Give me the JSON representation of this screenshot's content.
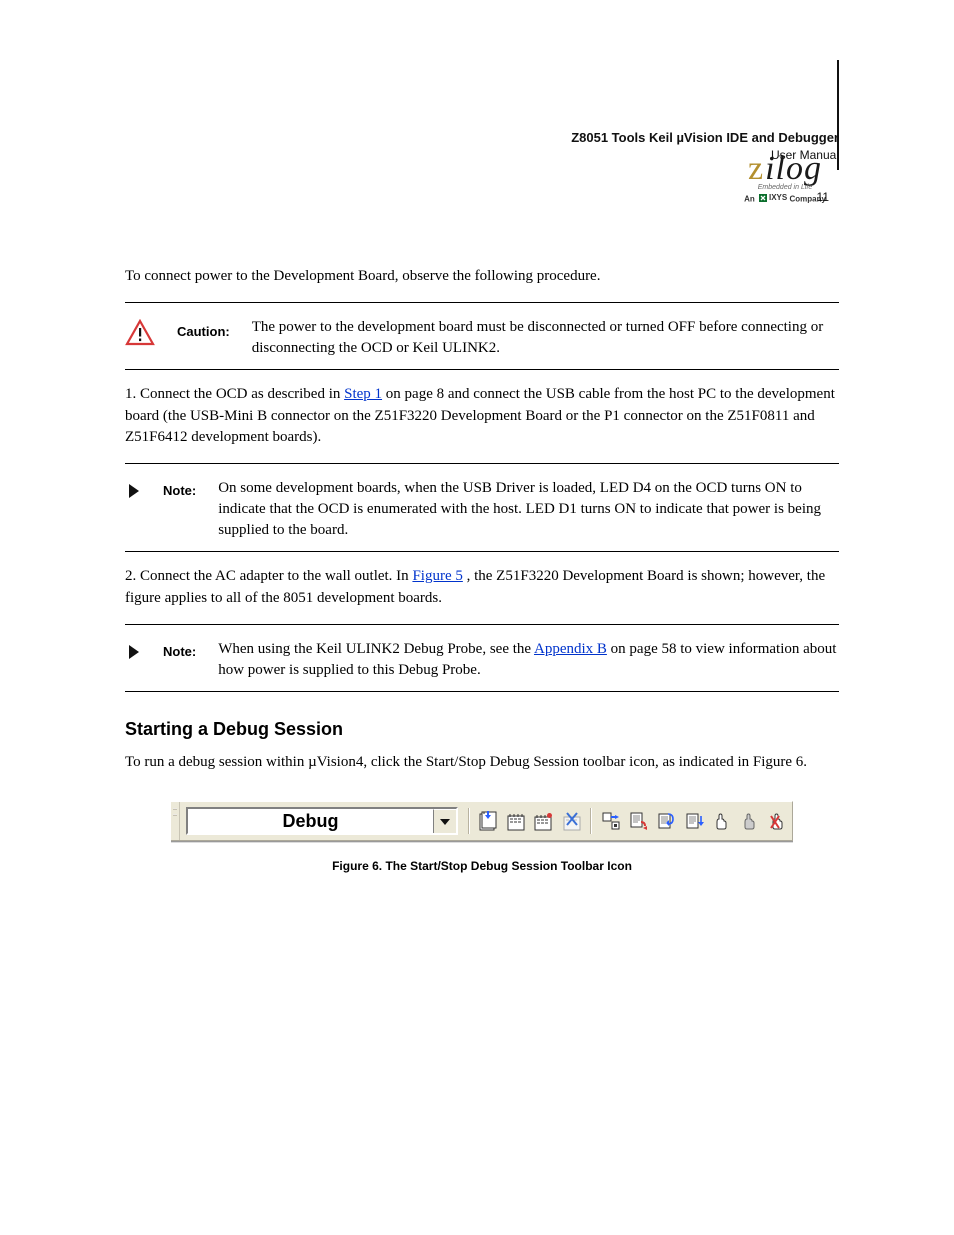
{
  "meta": {
    "doc_title": "Z8051 Tools Keil µVision IDE and Debugger",
    "doc_sub": "User Manual",
    "page_label": "11"
  },
  "logo": {
    "word": "ilog",
    "tagline": "Embedded in Life",
    "company_prefix": "An ",
    "company_brand": "IXYS",
    "company_suffix": " Company"
  },
  "intro_para": "To connect power to the Development Board, observe the following procedure.",
  "caution": {
    "label": "Caution:",
    "text": "The power to the development board must be disconnected or turned OFF before connecting or disconnecting the OCD or Keil ULINK2."
  },
  "step1": {
    "prefix": "1. Connect the OCD as described in ",
    "link_text": "Step 1",
    "suffix": " on page 8 and connect the USB cable from the host PC to the development board (the USB-Mini B connector on the Z51F3220 Development Board or the P1 connector on the Z51F0811 and Z51F6412 development boards)."
  },
  "note1": {
    "label": "Note:",
    "text": "On some development boards, when the USB Driver is loaded, LED D4 on the OCD turns ON to indicate that the OCD is enumerated with the host. LED D1 turns ON to indicate that power is being supplied to the board."
  },
  "step2": {
    "prefix": "2. Connect the AC adapter to the wall outlet. In ",
    "link_text": "Figure 5",
    "suffix": ", the Z51F3220 Development Board is shown; however, the figure applies to all of the 8051 development boards."
  },
  "note2": {
    "label": "Note:",
    "text_prefix": "When using the Keil ULINK2 Debug Probe, see the ",
    "link_text": "Appendix B",
    "text_suffix": " on page 58 to view information about how power is supplied to this Debug Probe."
  },
  "heading": "Starting a Debug Session",
  "final_para": "To run a debug session within µVision4, click the Start/Stop Debug Session toolbar icon, as indicated in Figure 6.",
  "toolbar": {
    "combo_value": "Debug"
  },
  "figure_caption": "Figure 6. The Start/Stop Debug Session Toolbar Icon",
  "icons": {
    "caution": "caution-icon",
    "note_arrow": "note-arrow-icon"
  }
}
